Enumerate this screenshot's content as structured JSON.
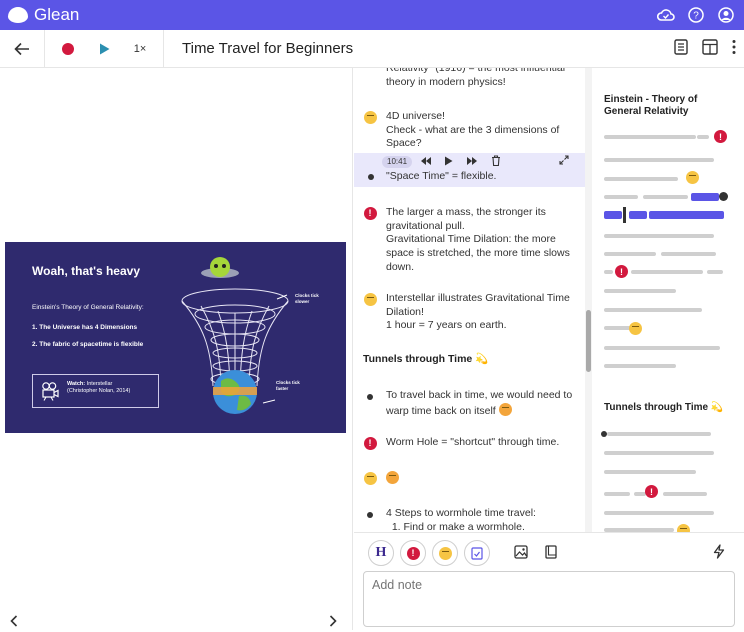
{
  "app": {
    "name": "Glean"
  },
  "toolbar": {
    "title": "Time Travel for Beginners",
    "speed": "1×"
  },
  "slide": {
    "title": "Woah, that's heavy",
    "subtitle": "Einstein's Theory of General Relativity:",
    "points": [
      "1.    The Universe has 4 Dimensions",
      "2.    The fabric of spacetime is flexible"
    ],
    "watch_label": "Watch:",
    "watch_title": "Interstellar",
    "watch_credit": "(Christopher Nolan, 2014)",
    "note_top": "Clocks tick slower",
    "note_bottom": "Clocks tick faster"
  },
  "notes": {
    "n0": "Relativity\" (1916) = the most influential theory in modern physics!",
    "n1": "4D universe!\nCheck - what are the 3 dimensions of Space?",
    "player_time": "10:41",
    "n2": "\"Space Time\" = flexible.",
    "n3": "The larger a mass, the stronger its gravitational pull.\nGravitational Time Dilation: the more space is stretched, the more time slows down.",
    "n4": "Interstellar illustrates Gravitational Time Dilation!\n1 hour = 7 years on earth.",
    "section2": "Tunnels through Time",
    "n5": "To travel back in time, we would need to warp time back on itself",
    "n6": "Worm Hole = \"shortcut\" through time.",
    "n8": "4 Steps to wormhole time travel:\n  1. Find or make a wormhole."
  },
  "minimap": {
    "section1": "Einstein - Theory of General Relativity",
    "section2": "Tunnels through Time"
  },
  "composer": {
    "placeholder": "Add note",
    "h_label": "H"
  },
  "colors": {
    "brand": "#5b55e6",
    "important": "#d2193e"
  }
}
